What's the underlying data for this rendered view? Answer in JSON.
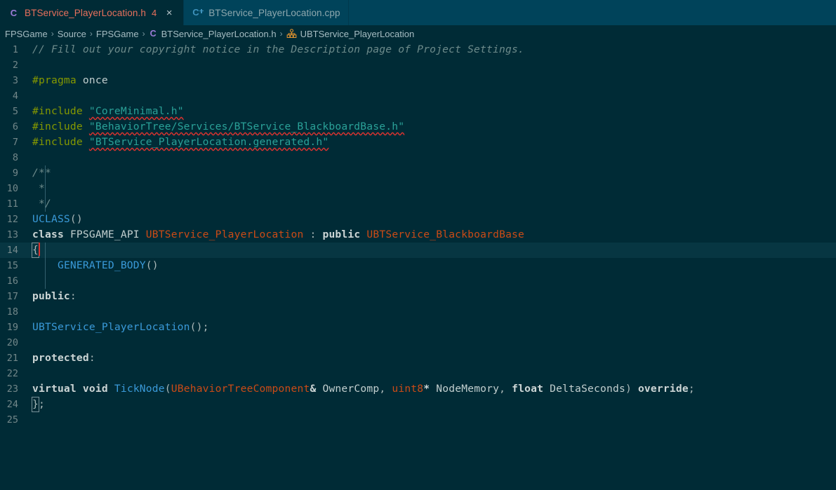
{
  "window": {
    "app": "Visual Studio Code",
    "colors": {
      "editor_background": "#002b36",
      "tabbar_background": "#00435a",
      "current_line": "#073642",
      "accent_blue": "#3a9ad9",
      "type_orange": "#cb4b16",
      "string_cyan": "#2aa198",
      "preprocessor_green": "#859900",
      "error_red": "#dc322f",
      "modified_salmon": "#e8705c"
    }
  },
  "tabs": [
    {
      "label": "BTService_PlayerLocation.h",
      "icon": "c-header-file-icon",
      "badge": "4",
      "close": "×",
      "active": true
    },
    {
      "label": "BTService_PlayerLocation.cpp",
      "icon": "cpp-source-file-icon",
      "active": false
    }
  ],
  "breadcrumb": {
    "separator": "›",
    "items": [
      {
        "label": "FPSGame",
        "icon": null
      },
      {
        "label": "Source",
        "icon": null
      },
      {
        "label": "FPSGame",
        "icon": null
      },
      {
        "label": "BTService_PlayerLocation.h",
        "icon": "c-header-file-icon"
      },
      {
        "label": "UBTService_PlayerLocation",
        "icon": "class-symbol-icon"
      }
    ]
  },
  "editor": {
    "language": "C++ Header",
    "cursor_line": 14,
    "total_lines": 25,
    "lines": [
      {
        "n": "1",
        "tokens": [
          {
            "t": "// Fill out your copyright notice in the Description page of Project Settings.",
            "c": "cmt"
          }
        ]
      },
      {
        "n": "2",
        "tokens": []
      },
      {
        "n": "3",
        "tokens": [
          {
            "t": "#pragma",
            "c": "pp"
          },
          {
            "t": " ",
            "c": "plain"
          },
          {
            "t": "once",
            "c": "plain"
          }
        ]
      },
      {
        "n": "4",
        "tokens": []
      },
      {
        "n": "5",
        "tokens": [
          {
            "t": "#include",
            "c": "pp"
          },
          {
            "t": " ",
            "c": "plain"
          },
          {
            "t": "\"CoreMinimal.h\"",
            "c": "str squig"
          }
        ]
      },
      {
        "n": "6",
        "tokens": [
          {
            "t": "#include",
            "c": "pp"
          },
          {
            "t": " ",
            "c": "plain"
          },
          {
            "t": "\"BehaviorTree/Services/BTService_BlackboardBase.h\"",
            "c": "str squig"
          }
        ]
      },
      {
        "n": "7",
        "tokens": [
          {
            "t": "#include",
            "c": "pp"
          },
          {
            "t": " ",
            "c": "plain"
          },
          {
            "t": "\"BTService_PlayerLocation.generated.h\"",
            "c": "str squig"
          }
        ]
      },
      {
        "n": "8",
        "tokens": []
      },
      {
        "n": "9",
        "tokens": [
          {
            "t": "/**",
            "c": "cmt"
          }
        ]
      },
      {
        "n": "10",
        "tokens": [
          {
            "t": " *",
            "c": "cmt"
          }
        ]
      },
      {
        "n": "11",
        "tokens": [
          {
            "t": " */",
            "c": "cmt"
          }
        ]
      },
      {
        "n": "12",
        "tokens": [
          {
            "t": "UCLASS",
            "c": "id"
          },
          {
            "t": "()",
            "c": "punct"
          }
        ]
      },
      {
        "n": "13",
        "tokens": [
          {
            "t": "class",
            "c": "kw"
          },
          {
            "t": " ",
            "c": "plain"
          },
          {
            "t": "FPSGAME_API",
            "c": "plain"
          },
          {
            "t": " ",
            "c": "plain"
          },
          {
            "t": "UBTService_PlayerLocation",
            "c": "type"
          },
          {
            "t": " ",
            "c": "plain"
          },
          {
            "t": ":",
            "c": "punct"
          },
          {
            "t": " ",
            "c": "plain"
          },
          {
            "t": "public",
            "c": "kw"
          },
          {
            "t": " ",
            "c": "plain"
          },
          {
            "t": "UBTService_BlackboardBase",
            "c": "type"
          }
        ]
      },
      {
        "n": "14",
        "tokens": [
          {
            "t": "{",
            "c": "punct bracketbox"
          }
        ],
        "cursor": true,
        "highlight": true
      },
      {
        "n": "15",
        "tokens": [
          {
            "t": "    ",
            "c": "plain"
          },
          {
            "t": "GENERATED_BODY",
            "c": "id"
          },
          {
            "t": "()",
            "c": "punct"
          }
        ]
      },
      {
        "n": "16",
        "tokens": []
      },
      {
        "n": "17",
        "tokens": [
          {
            "t": "public",
            "c": "kw"
          },
          {
            "t": ":",
            "c": "punct"
          }
        ]
      },
      {
        "n": "18",
        "tokens": []
      },
      {
        "n": "19",
        "tokens": [
          {
            "t": "UBTService_PlayerLocation",
            "c": "id"
          },
          {
            "t": "();",
            "c": "punct"
          }
        ]
      },
      {
        "n": "20",
        "tokens": []
      },
      {
        "n": "21",
        "tokens": [
          {
            "t": "protected",
            "c": "kw"
          },
          {
            "t": ":",
            "c": "punct"
          }
        ]
      },
      {
        "n": "22",
        "tokens": []
      },
      {
        "n": "23",
        "tokens": [
          {
            "t": "virtual",
            "c": "kw"
          },
          {
            "t": " ",
            "c": "plain"
          },
          {
            "t": "void",
            "c": "kw"
          },
          {
            "t": " ",
            "c": "plain"
          },
          {
            "t": "TickNode",
            "c": "fn"
          },
          {
            "t": "(",
            "c": "punct"
          },
          {
            "t": "UBehaviorTreeComponent",
            "c": "type"
          },
          {
            "t": "&",
            "c": "kw"
          },
          {
            "t": " ",
            "c": "plain"
          },
          {
            "t": "OwnerComp",
            "c": "plain"
          },
          {
            "t": ",",
            "c": "punct"
          },
          {
            "t": " ",
            "c": "plain"
          },
          {
            "t": "uint8",
            "c": "type"
          },
          {
            "t": "*",
            "c": "kw"
          },
          {
            "t": " ",
            "c": "plain"
          },
          {
            "t": "NodeMemory",
            "c": "plain"
          },
          {
            "t": ",",
            "c": "punct"
          },
          {
            "t": " ",
            "c": "plain"
          },
          {
            "t": "float",
            "c": "kw"
          },
          {
            "t": " ",
            "c": "plain"
          },
          {
            "t": "DeltaSeconds",
            "c": "plain"
          },
          {
            "t": ")",
            "c": "punct"
          },
          {
            "t": " ",
            "c": "plain"
          },
          {
            "t": "override",
            "c": "kw"
          },
          {
            "t": ";",
            "c": "punct"
          }
        ]
      },
      {
        "n": "24",
        "tokens": [
          {
            "t": "}",
            "c": "punct bracketbox"
          },
          {
            "t": ";",
            "c": "punct"
          }
        ]
      },
      {
        "n": "25",
        "tokens": []
      }
    ],
    "indent_guides": [
      {
        "from_line": 9,
        "to_line": 11,
        "col": 1
      },
      {
        "from_line": 14,
        "to_line": 16,
        "col": 1
      }
    ]
  }
}
